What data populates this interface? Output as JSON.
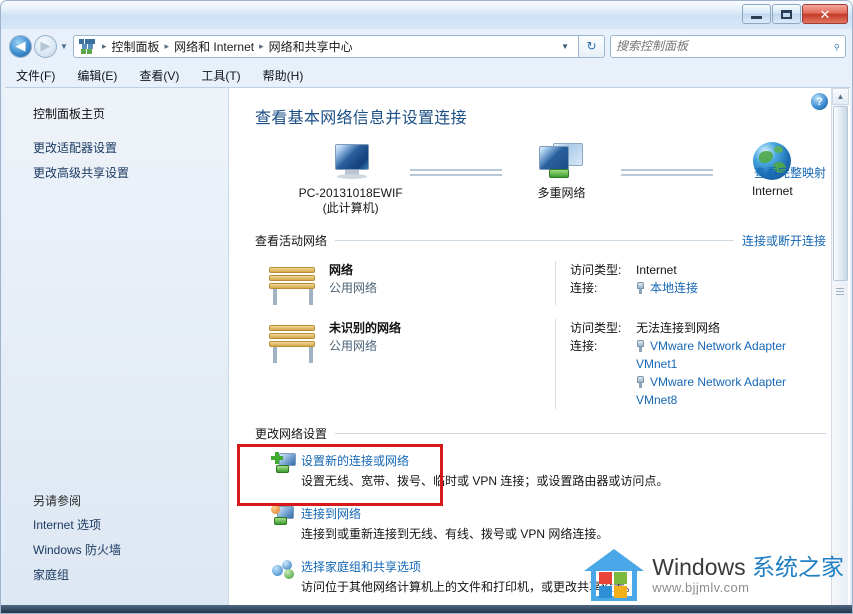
{
  "window": {
    "controls": {
      "minimize": "–",
      "maximize": "□",
      "close": "✕"
    }
  },
  "addressbar": {
    "back_icon": "back-arrow",
    "forward_icon": "forward-arrow",
    "history_icon": "chevron-down",
    "breadcrumb": [
      "控制面板",
      "网络和 Internet",
      "网络和共享中心"
    ],
    "separator": "▸",
    "dropdown": "▼",
    "refresh_icon": "↻",
    "search": {
      "placeholder": "搜索控制面板",
      "value": "",
      "icon": "search-icon"
    }
  },
  "menubar": {
    "items": [
      "文件(F)",
      "编辑(E)",
      "查看(V)",
      "工具(T)",
      "帮助(H)"
    ]
  },
  "sidebar": {
    "home": "控制面板主页",
    "links": [
      "更改适配器设置",
      "更改高级共享设置"
    ],
    "see_also_heading": "另请参阅",
    "see_also": [
      "Internet 选项",
      "Windows 防火墙",
      "家庭组"
    ]
  },
  "content": {
    "help_icon": "?",
    "page_title": "查看基本网络信息并设置连接",
    "map": {
      "nodes": [
        {
          "label": "PC-20131018EWIF",
          "sublabel": "(此计算机)",
          "icon": "computer-icon"
        },
        {
          "label": "多重网络",
          "sublabel": "",
          "icon": "multiple-networks-icon"
        },
        {
          "label": "Internet",
          "sublabel": "",
          "icon": "globe-icon"
        }
      ],
      "full_map_link": "查看完整映射"
    },
    "active_networks": {
      "heading": "查看活动网络",
      "action_link": "连接或断开连接",
      "rows": [
        {
          "name": "网络",
          "type": "公用网络",
          "access_label": "访问类型:",
          "access_value": "Internet",
          "conn_label": "连接:",
          "connections": [
            "本地连接"
          ]
        },
        {
          "name": "未识别的网络",
          "type": "公用网络",
          "access_label": "访问类型:",
          "access_value": "无法连接到网络",
          "conn_label": "连接:",
          "connections": [
            "VMware Network Adapter VMnet1",
            "VMware Network Adapter VMnet8"
          ]
        }
      ]
    },
    "change_settings": {
      "heading": "更改网络设置",
      "tasks": [
        {
          "link": "设置新的连接或网络",
          "desc": "设置无线、宽带、拨号、临时或 VPN 连接；或设置路由器或访问点。",
          "icon": "new-connection-icon",
          "highlighted": true
        },
        {
          "link": "连接到网络",
          "desc": "连接到或重新连接到无线、有线、拨号或 VPN 网络连接。",
          "icon": "connect-to-network-icon",
          "highlighted": false
        },
        {
          "link": "选择家庭组和共享选项",
          "desc": "访问位于其他网络计算机上的文件和打印机，或更改共享设置。",
          "icon": "homegroup-icon",
          "highlighted": false
        }
      ]
    }
  },
  "scrollbar": {
    "up_arrow": "▲",
    "down_arrow": "▼"
  },
  "watermark": {
    "brand_en": "Windows ",
    "brand_cn": "系统之家",
    "url": "www.bjjmlv.com"
  },
  "colors": {
    "link": "#1567b5",
    "title": "#1b4f86",
    "highlight": "#d61a1a",
    "close": "#c43a28"
  }
}
